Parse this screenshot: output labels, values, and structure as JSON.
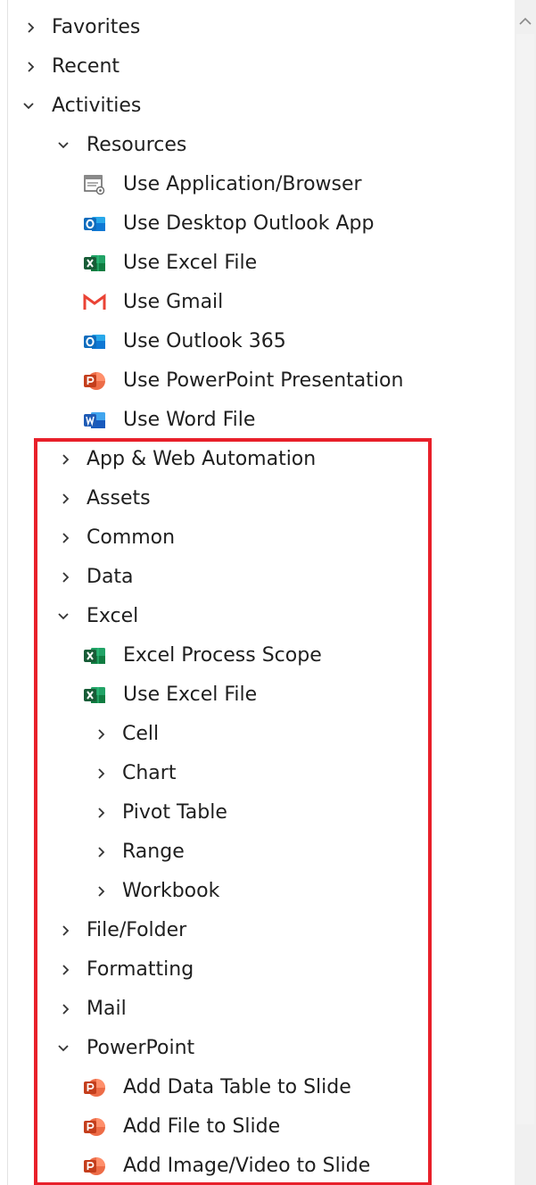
{
  "tree": {
    "favorites": "Favorites",
    "recent": "Recent",
    "activities": "Activities",
    "resources": {
      "label": "Resources",
      "items": [
        "Use Application/Browser",
        "Use Desktop Outlook App",
        "Use Excel File",
        "Use Gmail",
        "Use Outlook 365",
        "Use PowerPoint Presentation",
        "Use Word File"
      ]
    },
    "app_web_automation": "App & Web Automation",
    "assets": "Assets",
    "common": "Common",
    "data": "Data",
    "excel": {
      "label": "Excel",
      "items": [
        "Excel Process Scope",
        "Use Excel File"
      ],
      "groups": [
        "Cell",
        "Chart",
        "Pivot Table",
        "Range",
        "Workbook"
      ]
    },
    "file_folder": "File/Folder",
    "formatting": "Formatting",
    "mail": "Mail",
    "powerpoint": {
      "label": "PowerPoint",
      "items": [
        "Add Data Table to Slide",
        "Add File to Slide",
        "Add Image/Video to Slide"
      ]
    }
  },
  "icons": {
    "application-browser": "application-browser-icon",
    "outlook": "outlook-icon",
    "excel": "excel-icon",
    "gmail": "gmail-icon",
    "powerpoint": "powerpoint-icon",
    "word": "word-icon",
    "chevron-right": "chevron-right-icon",
    "chevron-down": "chevron-down-icon",
    "scroll-up": "scroll-up-arrow-icon"
  },
  "colors": {
    "highlight": "#e8202a",
    "excel": "#1d6f42",
    "outlook": "#0f6cbd",
    "word": "#1f5bb5",
    "powerpoint": "#c4421f",
    "gmail": "#ea4335"
  }
}
